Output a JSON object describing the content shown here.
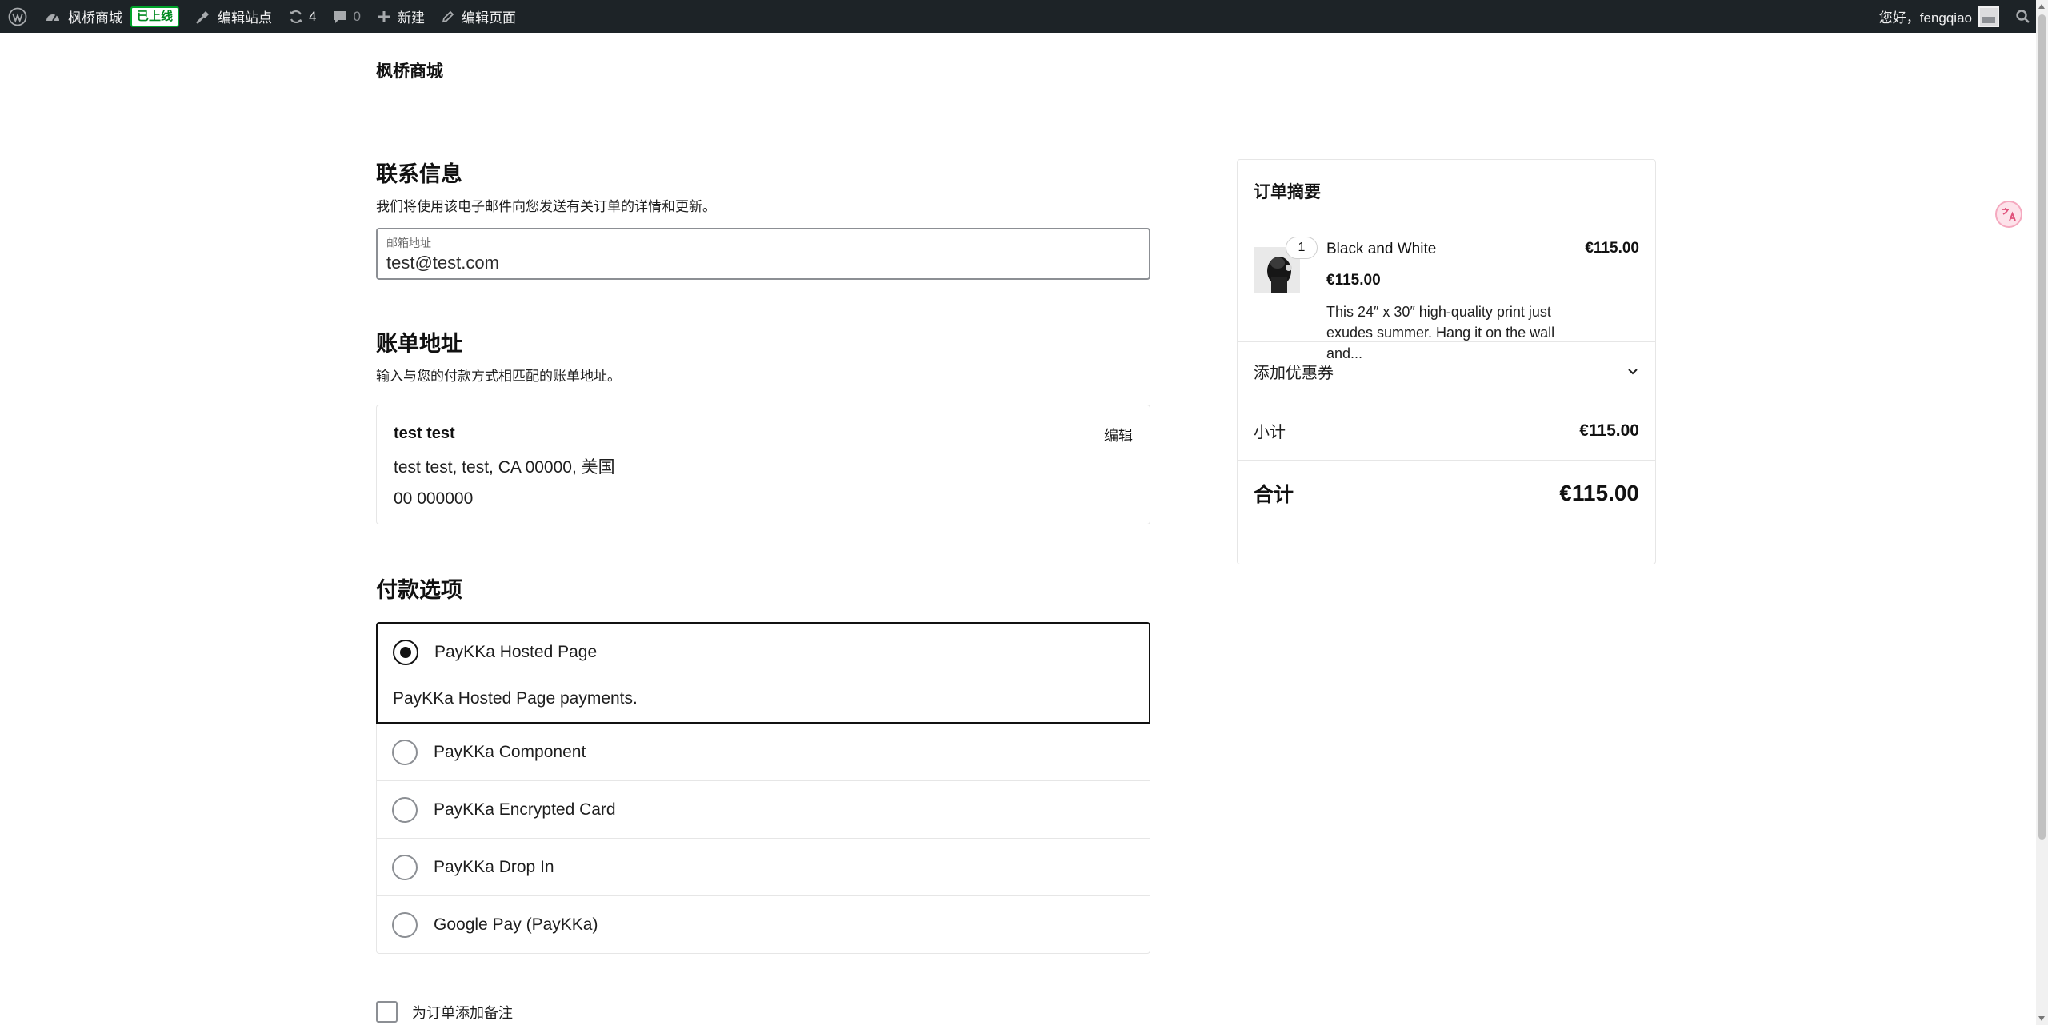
{
  "adminbar": {
    "site_name": "枫桥商城",
    "live_badge": "已上线",
    "edit_site": "编辑站点",
    "updates_count": "4",
    "comments_count": "0",
    "new_label": "新建",
    "edit_page": "编辑页面",
    "greeting": "您好，fengqiao"
  },
  "site": {
    "title": "枫桥商城"
  },
  "contact": {
    "title": "联系信息",
    "description": "我们将使用该电子邮件向您发送有关订单的详情和更新。",
    "email_label": "邮箱地址",
    "email_value": "test@test.com"
  },
  "billing": {
    "title": "账单地址",
    "description": "输入与您的付款方式相匹配的账单地址。",
    "name": "test test",
    "address": "test test, test, CA 00000, 美国",
    "phone": "00 000000",
    "edit_label": "编辑"
  },
  "payment": {
    "title": "付款选项",
    "options": [
      {
        "label": "PayKKa Hosted Page",
        "selected": true,
        "description": "PayKKa Hosted Page payments."
      },
      {
        "label": "PayKKa Component",
        "selected": false
      },
      {
        "label": "PayKKa Encrypted Card",
        "selected": false
      },
      {
        "label": "PayKKa Drop In",
        "selected": false
      },
      {
        "label": "Google Pay (PayKKa)",
        "selected": false
      }
    ]
  },
  "order_note": {
    "label": "为订单添加备注"
  },
  "summary": {
    "title": "订单摘要",
    "item": {
      "quantity": "1",
      "name": "Black and White",
      "price": "€115.00",
      "unit_price": "€115.00",
      "description": "This 24″ x 30″ high-quality print just exudes summer. Hang it on the wall and..."
    },
    "coupon_label": "添加优惠券",
    "subtotal_label": "小计",
    "subtotal_value": "€115.00",
    "total_label": "合计",
    "total_value": "€115.00"
  },
  "icons": {
    "wordpress": "wordpress-logo-icon",
    "dashboard": "dashboard-icon",
    "brush": "brush-icon",
    "updates": "updates-icon",
    "comments": "comment-icon",
    "plus": "plus-icon",
    "pencil": "pencil-icon",
    "search": "search-icon",
    "chevron": "chevron-down-icon",
    "translate": "translate-icon"
  },
  "colors": {
    "adminbar_bg": "#1d2327",
    "live_badge": "#00a32a",
    "text": "#1e1e1e",
    "border": "#e6e6e6"
  }
}
